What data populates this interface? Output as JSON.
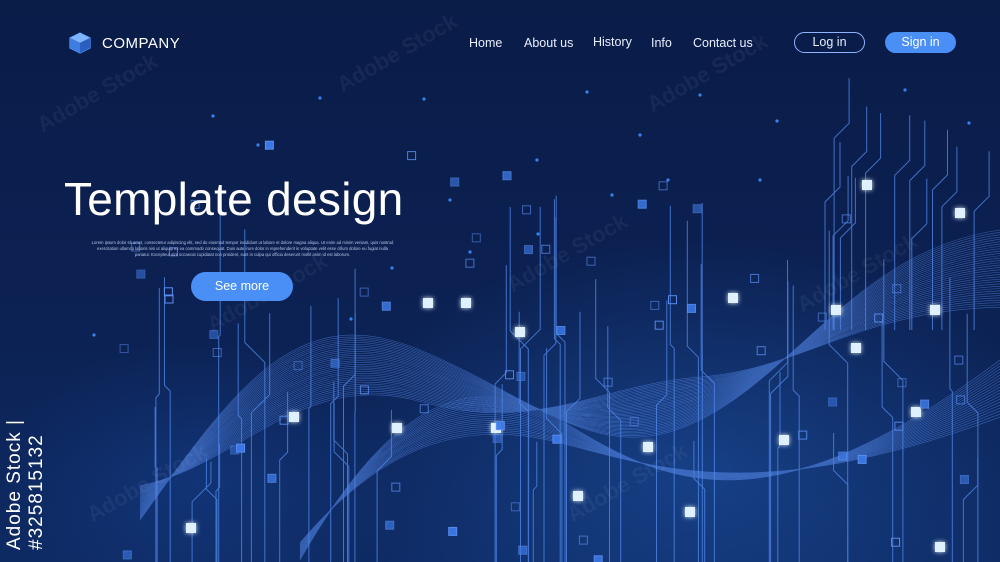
{
  "brand": {
    "name": "COMPANY",
    "logo_icon": "cube-logo-icon"
  },
  "nav": {
    "items": [
      {
        "label": "Home"
      },
      {
        "label": "About us"
      },
      {
        "label": "History"
      },
      {
        "label": "Info"
      },
      {
        "label": "Contact us"
      }
    ]
  },
  "auth": {
    "login_label": "Log in",
    "signin_label": "Sign in"
  },
  "hero": {
    "title": "Template design",
    "description": "Lorem ipsum dolor sit amet, consectetur adipiscing elit, sed do eiusmod tempor incididunt ut labore et dolore magna aliqua. Ut enim ad minim veniam, quis nostrud exercitation ullamco laboris nisi ut aliquip ex ea commodo consequat. Duis aute irure dolor in reprehenderit in voluptate velit esse cillum dolore eu fugiat nulla pariatur. Excepteur sint occaecat cupidatat non proident, sunt in culpa qui officia deserunt mollit anim id est laborum.",
    "button_label": "See more"
  },
  "stock": {
    "id_text": "Adobe Stock | #325815132",
    "watermark": "Adobe Stock"
  },
  "colors": {
    "background": "#0b1f4e",
    "accent": "#4a8ff5",
    "circuit_line": "#6fa3ff",
    "node_glow": "#cfe6ff"
  }
}
